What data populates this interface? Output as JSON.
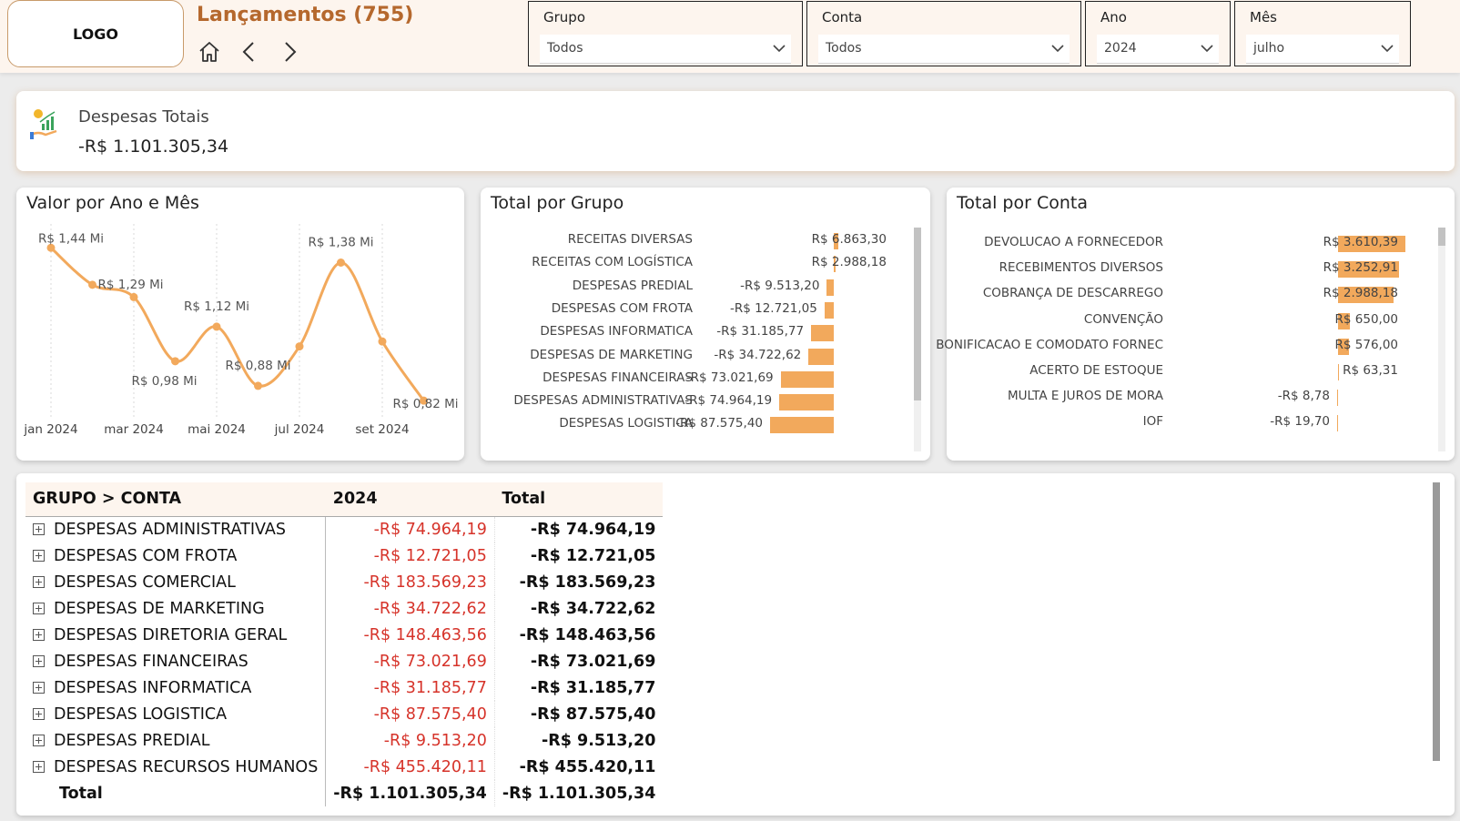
{
  "header": {
    "logo": "LOGO",
    "title": "Lançamentos (755)",
    "nav": {
      "home": "home-icon",
      "back": "chevron-left-icon",
      "forward": "chevron-right-icon"
    }
  },
  "filters": [
    {
      "label": "Grupo",
      "value": "Todos"
    },
    {
      "label": "Conta",
      "value": "Todos"
    },
    {
      "label": "Ano",
      "value": "2024"
    },
    {
      "label": "Mês",
      "value": "julho"
    }
  ],
  "kpi": {
    "label": "Despesas Totais",
    "value": "-R$ 1.101.305,34",
    "icon": "money-growth-icon"
  },
  "line_chart": {
    "title": "Valor por Ano e Mês",
    "chart_data": {
      "type": "line",
      "x": [
        "jan 2024",
        "fev 2024",
        "mar 2024",
        "abr 2024",
        "mai 2024",
        "jun 2024",
        "jul 2024",
        "ago 2024",
        "set 2024",
        "out 2024"
      ],
      "x_tick_labels": [
        "jan 2024",
        "mar 2024",
        "mai 2024",
        "jul 2024",
        "set 2024"
      ],
      "values": [
        1.44,
        1.29,
        1.24,
        0.98,
        1.12,
        0.88,
        1.04,
        1.38,
        1.06,
        0.82
      ],
      "data_labels": [
        "R$ 1,44 Mi",
        "R$ 1,29 Mi",
        "",
        "R$ 0,98 Mi",
        "R$ 1,12 Mi",
        "R$ 0,88 Mi",
        "",
        "R$ 1,38 Mi",
        "",
        "R$ 0,82 Mi"
      ],
      "color": "#f2a95c"
    }
  },
  "group_chart": {
    "title": "Total por Grupo",
    "chart_data": {
      "type": "bar",
      "orientation": "horizontal",
      "categories": [
        "RECEITAS DIVERSAS",
        "RECEITAS COM LOGÍSTICA",
        "DESPESAS PREDIAL",
        "DESPESAS COM FROTA",
        "DESPESAS INFORMATICA",
        "DESPESAS DE MARKETING",
        "DESPESAS FINANCEIRAS",
        "DESPESAS ADMINISTRATIVAS",
        "DESPESAS LOGISTICA"
      ],
      "values": [
        6863.3,
        2988.18,
        -9513.2,
        -12721.05,
        -31185.77,
        -34722.62,
        -73021.69,
        -74964.19,
        -87575.4
      ],
      "labels": [
        "R$ 6.863,30",
        "R$ 2.988,18",
        "-R$ 9.513,20",
        "-R$ 12.721,05",
        "-R$ 31.185,77",
        "-R$ 34.722,62",
        "-R$ 73.021,69",
        "-R$ 74.964,19",
        "-R$ 87.575,40"
      ],
      "color": "#f2a95c"
    }
  },
  "account_chart": {
    "title": "Total por Conta",
    "chart_data": {
      "type": "bar",
      "orientation": "horizontal",
      "categories": [
        "DEVOLUCAO A FORNECEDOR",
        "RECEBIMENTOS DIVERSOS",
        "COBRANÇA DE DESCARREGO",
        "CONVENÇÃO",
        "BONIFICACAO E COMODATO FORNEC",
        "ACERTO DE ESTOQUE",
        "MULTA E JUROS DE MORA",
        "IOF"
      ],
      "values": [
        3610.39,
        3252.91,
        2988.18,
        650.0,
        576.0,
        63.31,
        -8.78,
        -19.7
      ],
      "labels": [
        "R$ 3.610,39",
        "R$ 3.252,91",
        "R$ 2.988,18",
        "R$ 650,00",
        "R$ 576,00",
        "R$ 63,31",
        "-R$ 8,78",
        "-R$ 19,70"
      ],
      "color": "#f2a95c"
    }
  },
  "matrix": {
    "headers": [
      "GRUPO > CONTA",
      "2024",
      "Total"
    ],
    "rows": [
      {
        "name": "DESPESAS ADMINISTRATIVAS",
        "y2024": "-R$ 74.964,19",
        "total": "-R$ 74.964,19"
      },
      {
        "name": "DESPESAS COM FROTA",
        "y2024": "-R$ 12.721,05",
        "total": "-R$ 12.721,05"
      },
      {
        "name": "DESPESAS COMERCIAL",
        "y2024": "-R$ 183.569,23",
        "total": "-R$ 183.569,23"
      },
      {
        "name": "DESPESAS DE MARKETING",
        "y2024": "-R$ 34.722,62",
        "total": "-R$ 34.722,62"
      },
      {
        "name": "DESPESAS DIRETORIA GERAL",
        "y2024": "-R$ 148.463,56",
        "total": "-R$ 148.463,56"
      },
      {
        "name": "DESPESAS FINANCEIRAS",
        "y2024": "-R$ 73.021,69",
        "total": "-R$ 73.021,69"
      },
      {
        "name": "DESPESAS INFORMATICA",
        "y2024": "-R$ 31.185,77",
        "total": "-R$ 31.185,77"
      },
      {
        "name": "DESPESAS LOGISTICA",
        "y2024": "-R$ 87.575,40",
        "total": "-R$ 87.575,40"
      },
      {
        "name": "DESPESAS PREDIAL",
        "y2024": "-R$ 9.513,20",
        "total": "-R$ 9.513,20"
      },
      {
        "name": "DESPESAS RECURSOS HUMANOS",
        "y2024": "-R$ 455.420,11",
        "total": "-R$ 455.420,11"
      }
    ],
    "total_row": {
      "name": "Total",
      "y2024": "-R$ 1.101.305,34",
      "total": "-R$ 1.101.305,34"
    }
  }
}
